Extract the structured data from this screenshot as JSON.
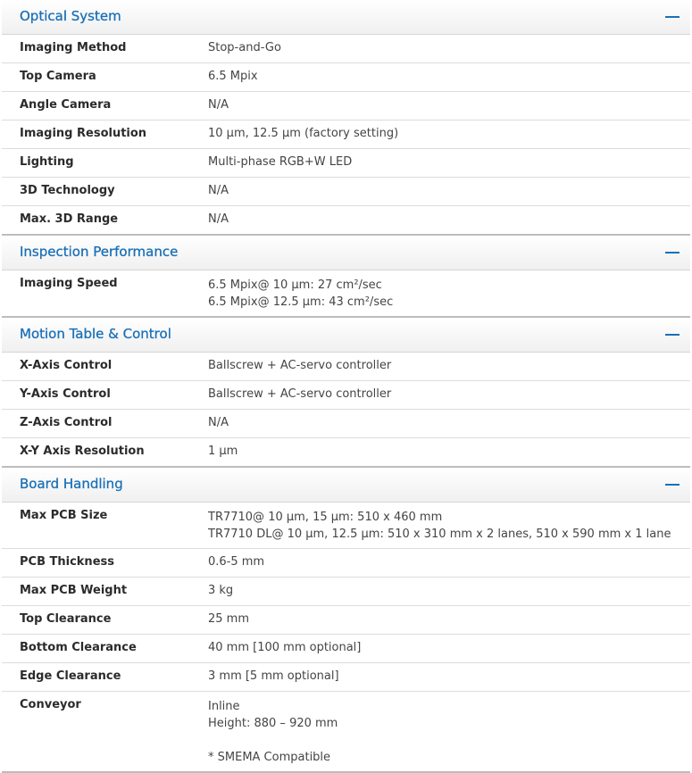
{
  "sections": [
    {
      "title": "Optical System",
      "rows": [
        {
          "label": "Imaging Method",
          "values": [
            "Stop-and-Go"
          ]
        },
        {
          "label": "Top Camera",
          "values": [
            "6.5 Mpix"
          ]
        },
        {
          "label": "Angle Camera",
          "values": [
            "N/A"
          ]
        },
        {
          "label": "Imaging Resolution",
          "values": [
            "10 µm, 12.5 µm (factory setting)"
          ]
        },
        {
          "label": "Lighting",
          "values": [
            "Multi-phase RGB+W LED"
          ]
        },
        {
          "label": "3D Technology",
          "values": [
            "N/A"
          ]
        },
        {
          "label": "Max. 3D Range",
          "values": [
            "N/A"
          ]
        }
      ]
    },
    {
      "title": "Inspection Performance",
      "rows": [
        {
          "label": "Imaging Speed",
          "values": [
            "6.5 Mpix@ 10 µm: 27 cm²/sec",
            "6.5 Mpix@ 12.5 µm: 43 cm²/sec"
          ]
        }
      ]
    },
    {
      "title": "Motion Table & Control",
      "rows": [
        {
          "label": "X-Axis Control",
          "values": [
            "Ballscrew + AC-servo controller"
          ]
        },
        {
          "label": "Y-Axis Control",
          "values": [
            "Ballscrew + AC-servo controller"
          ]
        },
        {
          "label": "Z-Axis Control",
          "values": [
            "N/A"
          ]
        },
        {
          "label": "X-Y Axis Resolution",
          "values": [
            "1 µm"
          ]
        }
      ]
    },
    {
      "title": "Board Handling",
      "rows": [
        {
          "label": "Max PCB Size",
          "values": [
            "TR7710@ 10 µm, 15 µm: 510 x 460 mm",
            "TR7710 DL@ 10 µm, 12.5 µm: 510 x 310 mm x 2 lanes, 510 x 590 mm x 1 lane"
          ]
        },
        {
          "label": "PCB Thickness",
          "values": [
            "0.6-5 mm"
          ]
        },
        {
          "label": "Max PCB Weight",
          "values": [
            "3 kg"
          ]
        },
        {
          "label": "Top Clearance",
          "values": [
            "25 mm"
          ]
        },
        {
          "label": "Bottom Clearance",
          "values": [
            "40 mm [100 mm optional]"
          ]
        },
        {
          "label": "Edge Clearance",
          "values": [
            "3 mm [5 mm optional]"
          ]
        },
        {
          "label": "Conveyor",
          "values": [
            "Inline",
            "Height: 880 – 920 mm",
            "",
            "* SMEMA Compatible"
          ]
        }
      ]
    }
  ],
  "icons": {
    "collapse": "minus-icon",
    "accent_color": "#1a70b8"
  }
}
